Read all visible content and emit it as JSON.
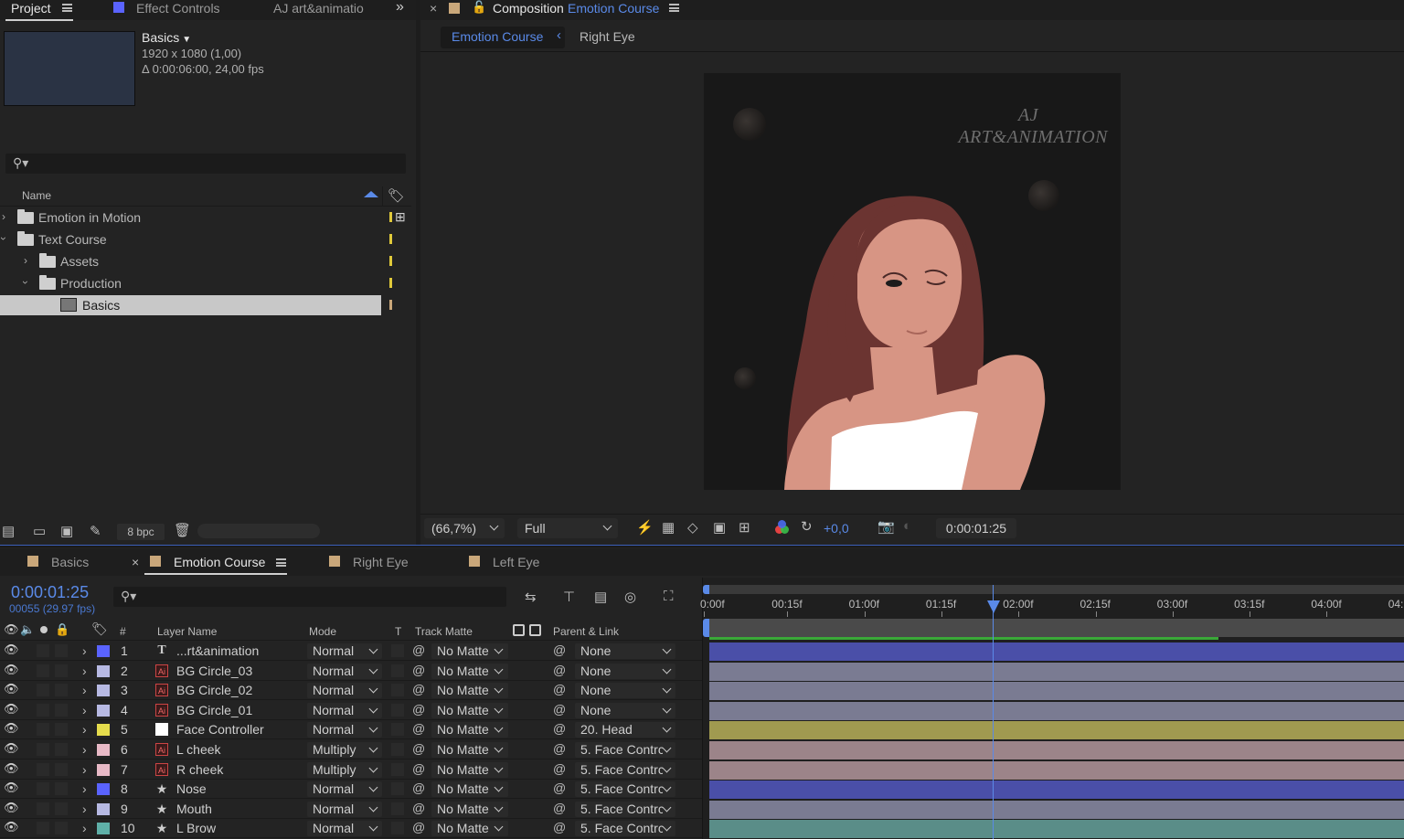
{
  "project_panel": {
    "tabs": [
      "Project",
      "Effect Controls",
      "AJ art&animatio"
    ],
    "item_name": "Basics",
    "item_dims": "1920 x 1080 (1,00)",
    "item_duration": "Δ 0:00:06:00, 24,00 fps",
    "column_name": "Name",
    "tree": [
      {
        "label": "Emotion in Motion",
        "type": "folder",
        "expanded": false,
        "level": 0
      },
      {
        "label": "Text Course",
        "type": "folder",
        "expanded": true,
        "level": 0
      },
      {
        "label": "Assets",
        "type": "folder",
        "expanded": false,
        "level": 1
      },
      {
        "label": "Production",
        "type": "folder",
        "expanded": true,
        "level": 1
      },
      {
        "label": "Basics",
        "type": "composition",
        "selected": true,
        "level": 2
      }
    ],
    "bpc": "8 bpc"
  },
  "composition_panel": {
    "label": "Composition",
    "comp_name": "Emotion Course",
    "breadcrumbs": [
      "Emotion Course",
      "Right Eye"
    ],
    "watermark_line1": "AJ",
    "watermark_line2": "ART&ANIMATION",
    "zoom": "(66,7%)",
    "resolution": "Full",
    "exposure": "+0,0",
    "timecode": "0:00:01:25"
  },
  "timeline": {
    "tabs": [
      {
        "label": "Basics",
        "color": "#c9a77a"
      },
      {
        "label": "Emotion Course",
        "color": "#c9a77a",
        "active": true
      },
      {
        "label": "Right Eye",
        "color": "#c9a77a"
      },
      {
        "label": "Left Eye",
        "color": "#c9a77a"
      }
    ],
    "current_time": "0:00:01:25",
    "frame_info": "00055 (29.97 fps)",
    "headers": {
      "number": "#",
      "layer_name": "Layer Name",
      "mode": "Mode",
      "t": "T",
      "track_matte": "Track Matte",
      "parent": "Parent & Link"
    },
    "ruler": [
      "0:00f",
      "00:15f",
      "01:00f",
      "01:15f",
      "02:00f",
      "02:15f",
      "03:00f",
      "03:15f",
      "04:00f",
      "04:"
    ],
    "playhead_time_sec": 1.83,
    "layers": [
      {
        "num": "1",
        "name": "...rt&animation",
        "type": "text",
        "label_color": "#5a63ff",
        "mode": "Normal",
        "matte": "No Matte",
        "parent": "None",
        "bar_color": "#4a4fa8"
      },
      {
        "num": "2",
        "name": "BG Circle_03",
        "type": "ai",
        "label_color": "#b7b9e3",
        "mode": "Normal",
        "matte": "No Matte",
        "parent": "None",
        "bar_color": "#7a7b92"
      },
      {
        "num": "3",
        "name": "BG Circle_02",
        "type": "ai",
        "label_color": "#b7b9e3",
        "mode": "Normal",
        "matte": "No Matte",
        "parent": "None",
        "bar_color": "#7a7b92"
      },
      {
        "num": "4",
        "name": "BG Circle_01",
        "type": "ai",
        "label_color": "#b7b9e3",
        "mode": "Normal",
        "matte": "No Matte",
        "parent": "None",
        "bar_color": "#7a7b92"
      },
      {
        "num": "5",
        "name": "Face Controller",
        "type": "solid",
        "label_color": "#e5dc4c",
        "mode": "Normal",
        "matte": "No Matte",
        "parent": "20. Head",
        "bar_color": "#a09a50"
      },
      {
        "num": "6",
        "name": "L cheek",
        "type": "ai",
        "label_color": "#e8b9c6",
        "mode": "Multiply",
        "matte": "No Matte",
        "parent": "5. Face Contrc",
        "bar_color": "#9c8489"
      },
      {
        "num": "7",
        "name": "R cheek",
        "type": "ai",
        "label_color": "#e8b9c6",
        "mode": "Multiply",
        "matte": "No Matte",
        "parent": "5. Face Contrc",
        "bar_color": "#9c8489"
      },
      {
        "num": "8",
        "name": "Nose",
        "type": "shape",
        "label_color": "#5a63ff",
        "mode": "Normal",
        "matte": "No Matte",
        "parent": "5. Face Contrc",
        "bar_color": "#4a4fa8"
      },
      {
        "num": "9",
        "name": "Mouth",
        "type": "shape",
        "label_color": "#b7b9e3",
        "mode": "Normal",
        "matte": "No Matte",
        "parent": "5. Face Contrc",
        "bar_color": "#7a7b92"
      },
      {
        "num": "10",
        "name": "L Brow",
        "type": "shape",
        "label_color": "#5fb0a8",
        "mode": "Normal",
        "matte": "No Matte",
        "parent": "5. Face Contrc",
        "bar_color": "#5a8d88"
      }
    ]
  }
}
